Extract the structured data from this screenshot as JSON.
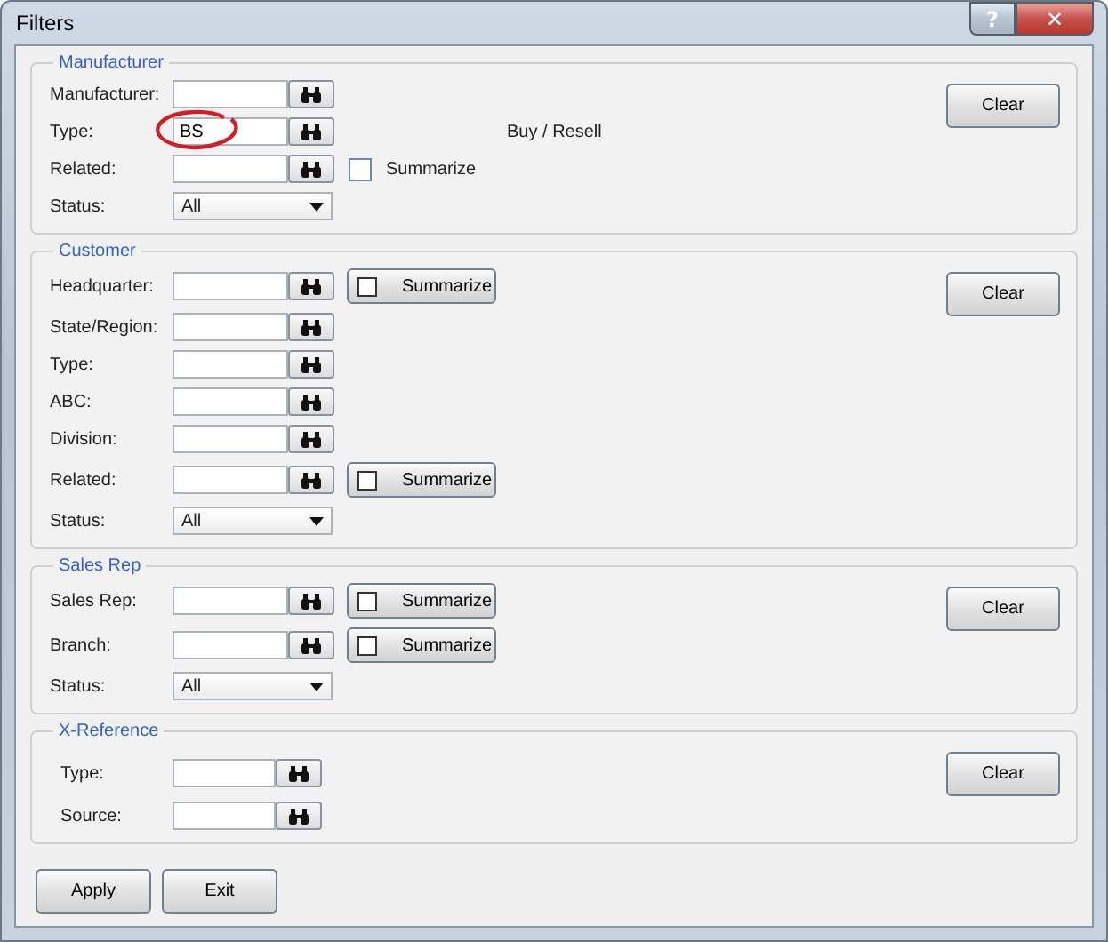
{
  "window": {
    "title": "Filters",
    "help": "?",
    "close": "✕"
  },
  "groups": [
    {
      "title": "Manufacturer",
      "clear": "Clear",
      "rows": [
        {
          "kind": "lookup",
          "label": "Manufacturer:",
          "value": ""
        },
        {
          "kind": "lookup",
          "label": "Type:",
          "value": "BS",
          "circled": true,
          "note": "Buy / Resell"
        },
        {
          "kind": "lookup",
          "label": "Related:",
          "value": "",
          "summarize": {
            "kind": "checkbox",
            "label": "Summarize",
            "checked": false
          }
        },
        {
          "kind": "select",
          "label": "Status:",
          "value": "All"
        }
      ]
    },
    {
      "title": "Customer",
      "clear": "Clear",
      "rows": [
        {
          "kind": "lookup",
          "label": "Headquarter:",
          "value": "",
          "summarize": {
            "kind": "button",
            "label": "Summarize",
            "checked": false
          }
        },
        {
          "kind": "lookup",
          "label": "State/Region:",
          "value": ""
        },
        {
          "kind": "lookup",
          "label": "Type:",
          "value": ""
        },
        {
          "kind": "lookup",
          "label": "ABC:",
          "value": ""
        },
        {
          "kind": "lookup",
          "label": "Division:",
          "value": ""
        },
        {
          "kind": "lookup",
          "label": "Related:",
          "value": "",
          "summarize": {
            "kind": "button",
            "label": "Summarize",
            "checked": false
          }
        },
        {
          "kind": "select",
          "label": "Status:",
          "value": "All"
        }
      ]
    },
    {
      "title": "Sales Rep",
      "clear": "Clear",
      "rows": [
        {
          "kind": "lookup",
          "label": "Sales Rep:",
          "value": "",
          "summarize": {
            "kind": "button",
            "label": "Summarize",
            "checked": false
          }
        },
        {
          "kind": "lookup",
          "label": "Branch:",
          "value": "",
          "summarize": {
            "kind": "button",
            "label": "Summarize",
            "checked": false
          }
        },
        {
          "kind": "select",
          "label": "Status:",
          "value": "All"
        }
      ]
    },
    {
      "title": "X-Reference",
      "clear": "Clear",
      "indented": true,
      "rows": [
        {
          "kind": "lookup",
          "label": "Type:",
          "value": ""
        },
        {
          "kind": "lookup",
          "label": "Source:",
          "value": ""
        }
      ]
    }
  ],
  "buttons": [
    "Apply",
    "Exit"
  ]
}
